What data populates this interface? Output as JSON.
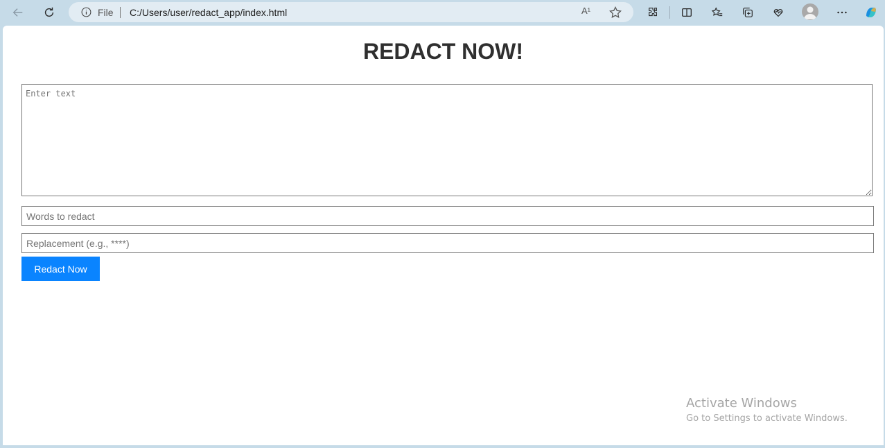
{
  "browser": {
    "file_label": "File",
    "url": "C:/Users/user/redact_app/index.html",
    "read_aloud_glyph": "A¹",
    "icons": [
      "back-arrow-icon",
      "reload-icon",
      "info-icon",
      "read-aloud-icon",
      "favorite-star-icon",
      "extensions-icon",
      "split-screen-icon",
      "favorites-icon",
      "collections-icon",
      "performance-icon",
      "profile-icon",
      "more-icon",
      "copilot-icon"
    ]
  },
  "page": {
    "title": "REDACT NOW!",
    "text_placeholder": "Enter text",
    "words_placeholder": "Words to redact",
    "replacement_placeholder": "Replacement (e.g., ****)",
    "button_label": "Redact Now",
    "button_color": "#0a84ff"
  },
  "watermark": {
    "title": "Activate Windows",
    "subtitle": "Go to Settings to activate Windows."
  }
}
